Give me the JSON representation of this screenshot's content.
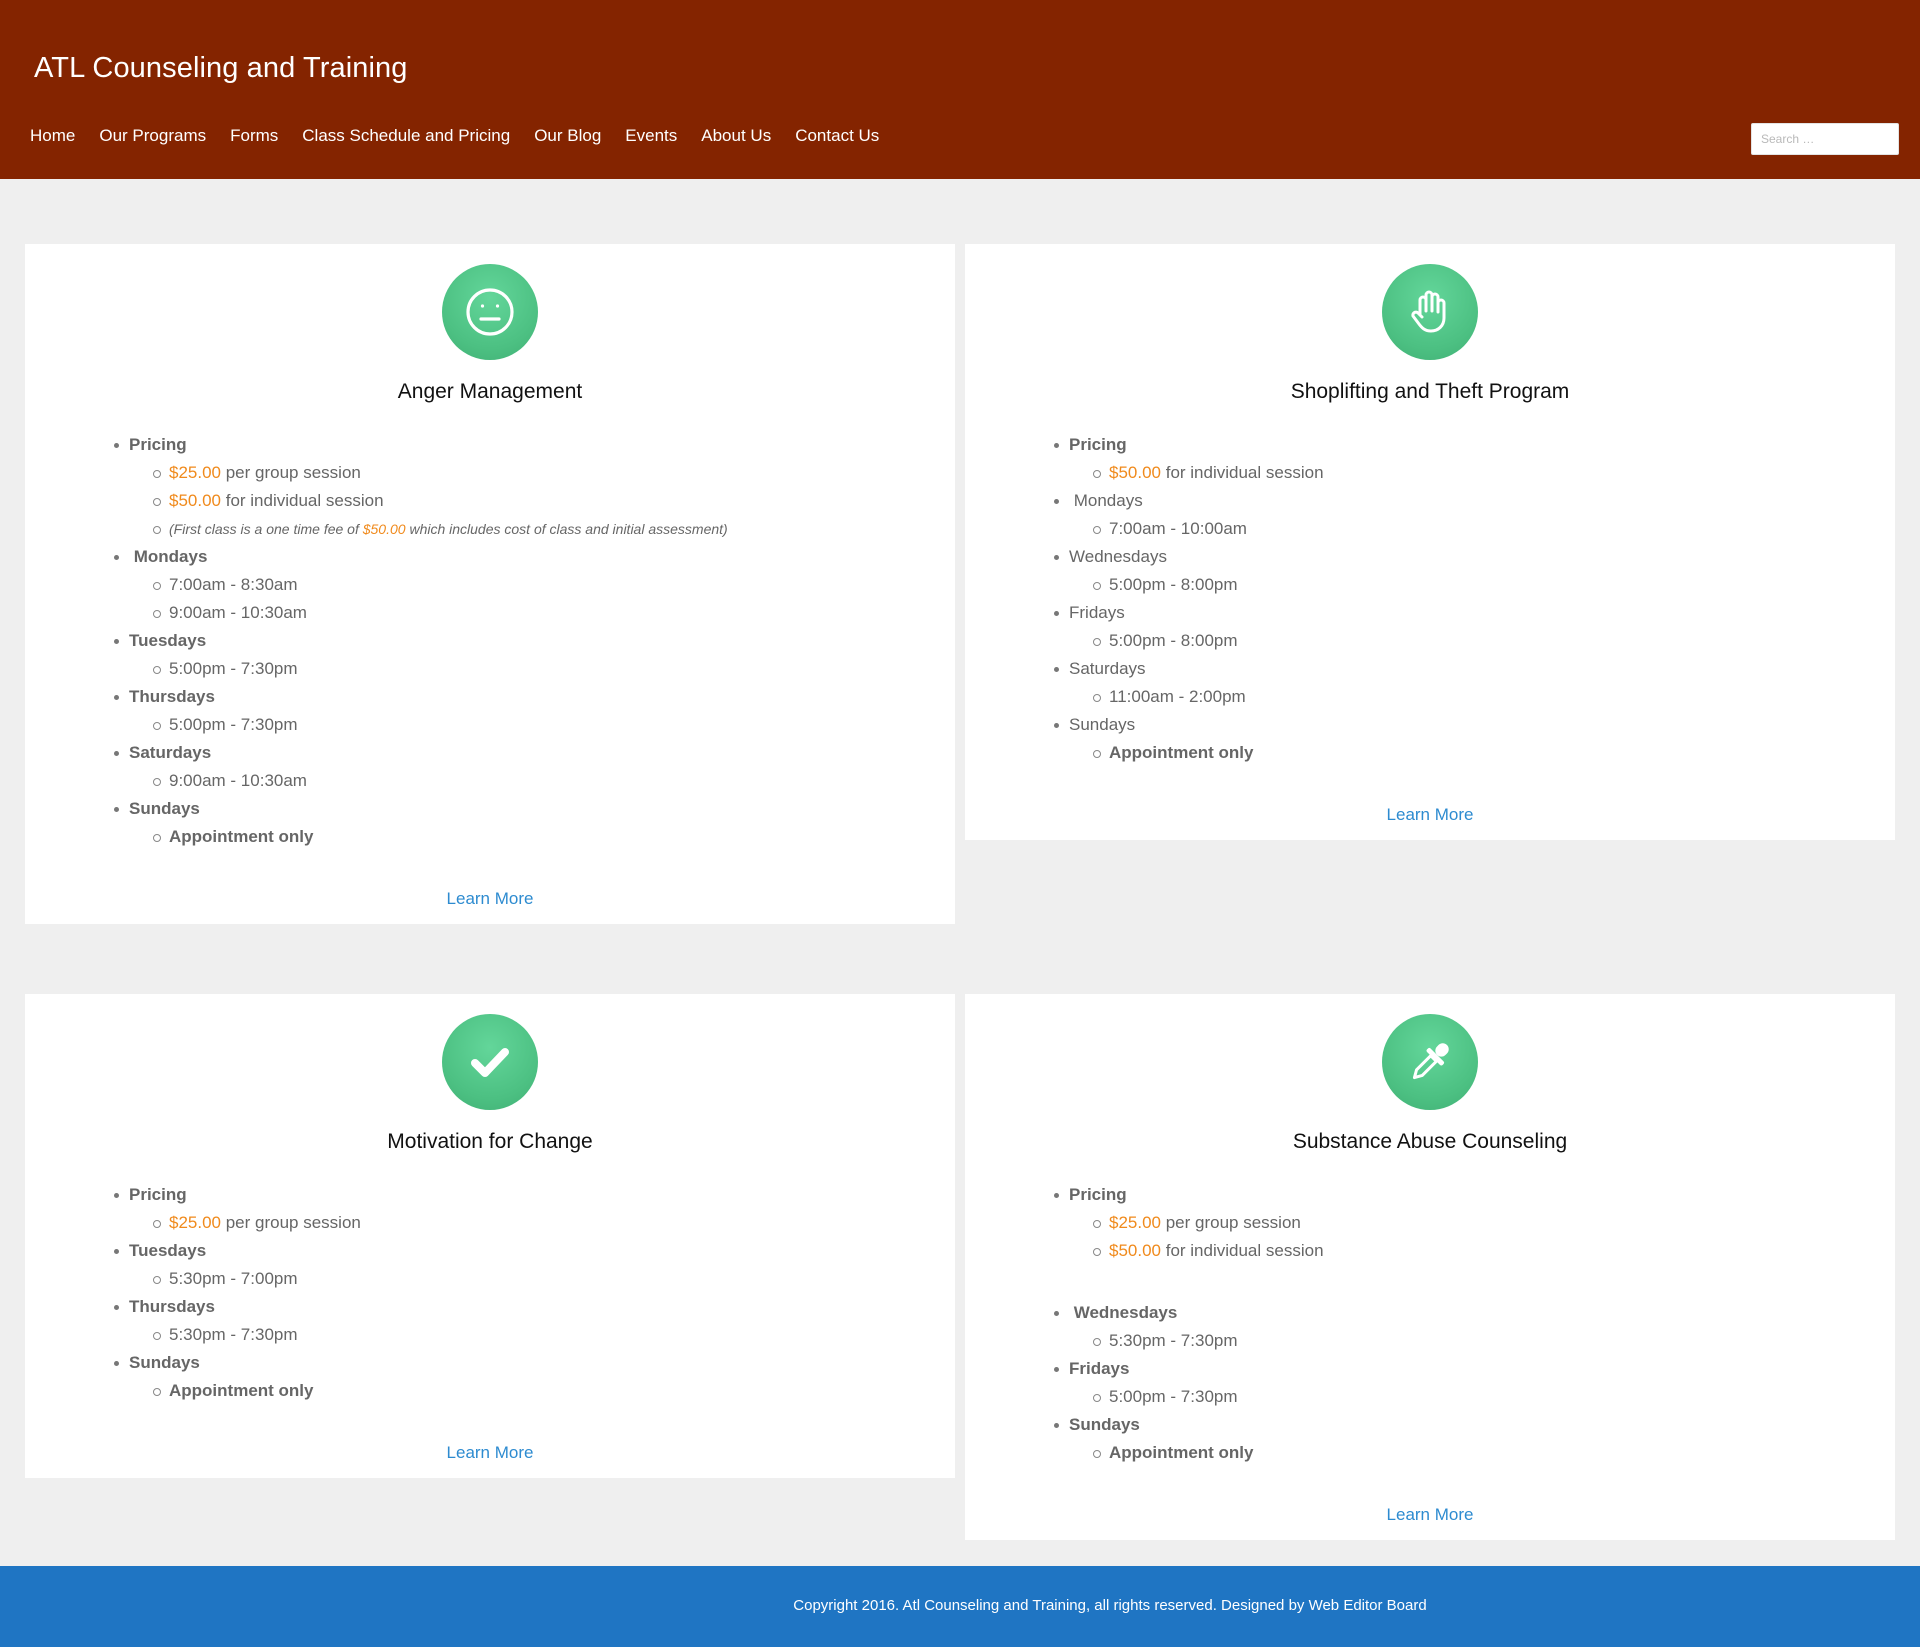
{
  "site_title": "ATL Counseling and Training",
  "nav": [
    "Home",
    "Our Programs",
    "Forms",
    "Class Schedule and Pricing",
    "Our Blog",
    "Events",
    "About Us",
    "Contact Us"
  ],
  "search": {
    "placeholder": "Search …"
  },
  "learn_more": "Learn More",
  "programs": [
    {
      "icon": "neutral-face-icon",
      "title": "Anger Management",
      "items": [
        {
          "label": "Pricing",
          "bold": true,
          "subs": [
            {
              "price": "$25.00",
              "text": " per group session"
            },
            {
              "price": "$50.00",
              "text": " for individual session"
            },
            {
              "note": true,
              "pre": "(First class is a one time fee of ",
              "price": "$50.00",
              "text": " which includes cost of class and initial assessment)"
            }
          ]
        },
        {
          "label": " Mondays",
          "bold": true,
          "subs": [
            {
              "text": "7:00am - 8:30am"
            },
            {
              "text": "9:00am - 10:30am"
            }
          ]
        },
        {
          "label": "Tuesdays",
          "bold": true,
          "subs": [
            {
              "text": "5:00pm - 7:30pm"
            }
          ]
        },
        {
          "label": "Thursdays",
          "bold": true,
          "subs": [
            {
              "text": "5:00pm - 7:30pm"
            }
          ]
        },
        {
          "label": "Saturdays",
          "bold": true,
          "subs": [
            {
              "text": "9:00am - 10:30am"
            }
          ]
        },
        {
          "label": "Sundays",
          "bold": true,
          "subs": [
            {
              "text": "Appointment only",
              "bold": true
            }
          ]
        }
      ]
    },
    {
      "icon": "raised-hand-icon",
      "title": "Shoplifting and Theft Program",
      "items": [
        {
          "label": "Pricing",
          "bold": true,
          "subs": [
            {
              "price": "$50.00",
              "text": " for individual session"
            }
          ]
        },
        {
          "label": " Mondays",
          "bold": false,
          "subs": [
            {
              "text": "7:00am - 10:00am"
            }
          ]
        },
        {
          "label": "Wednesdays",
          "bold": false,
          "subs": [
            {
              "text": "5:00pm - 8:00pm"
            }
          ]
        },
        {
          "label": "Fridays",
          "bold": false,
          "subs": [
            {
              "text": "5:00pm - 8:00pm"
            }
          ]
        },
        {
          "label": "Saturdays",
          "bold": false,
          "subs": [
            {
              "text": "11:00am - 2:00pm"
            }
          ]
        },
        {
          "label": "Sundays",
          "bold": false,
          "subs": [
            {
              "text": "Appointment only",
              "bold": true
            }
          ]
        }
      ]
    },
    {
      "icon": "checkmark-icon",
      "title": "Motivation for Change",
      "items": [
        {
          "label": "Pricing",
          "bold": true,
          "subs": [
            {
              "price": "$25.00",
              "text": " per group session"
            }
          ]
        },
        {
          "label": "Tuesdays",
          "bold": true,
          "subs": [
            {
              "text": "5:30pm - 7:00pm"
            }
          ]
        },
        {
          "label": "Thursdays",
          "bold": true,
          "subs": [
            {
              "text": "5:30pm - 7:30pm"
            }
          ]
        },
        {
          "label": "Sundays",
          "bold": true,
          "subs": [
            {
              "text": "Appointment only",
              "bold": true
            }
          ]
        }
      ]
    },
    {
      "icon": "eyedropper-icon",
      "title": "Substance Abuse Counseling",
      "items": [
        {
          "label": "Pricing",
          "bold": true,
          "subs": [
            {
              "price": "$25.00",
              "text": " per group session"
            },
            {
              "price": "$50.00",
              "text": " for individual session"
            }
          ]
        },
        {
          "label": " Wednesdays",
          "bold": true,
          "gap": true,
          "subs": [
            {
              "text": "5:30pm - 7:30pm"
            }
          ]
        },
        {
          "label": "Fridays",
          "bold": true,
          "subs": [
            {
              "text": "5:00pm - 7:30pm"
            }
          ]
        },
        {
          "label": "Sundays",
          "bold": true,
          "subs": [
            {
              "text": "Appointment only",
              "bold": true
            }
          ]
        }
      ]
    }
  ],
  "footer": {
    "text": "Copyright 2016. Atl Counseling and Training, all rights reserved. Designed by ",
    "link": "Web Editor Board"
  }
}
